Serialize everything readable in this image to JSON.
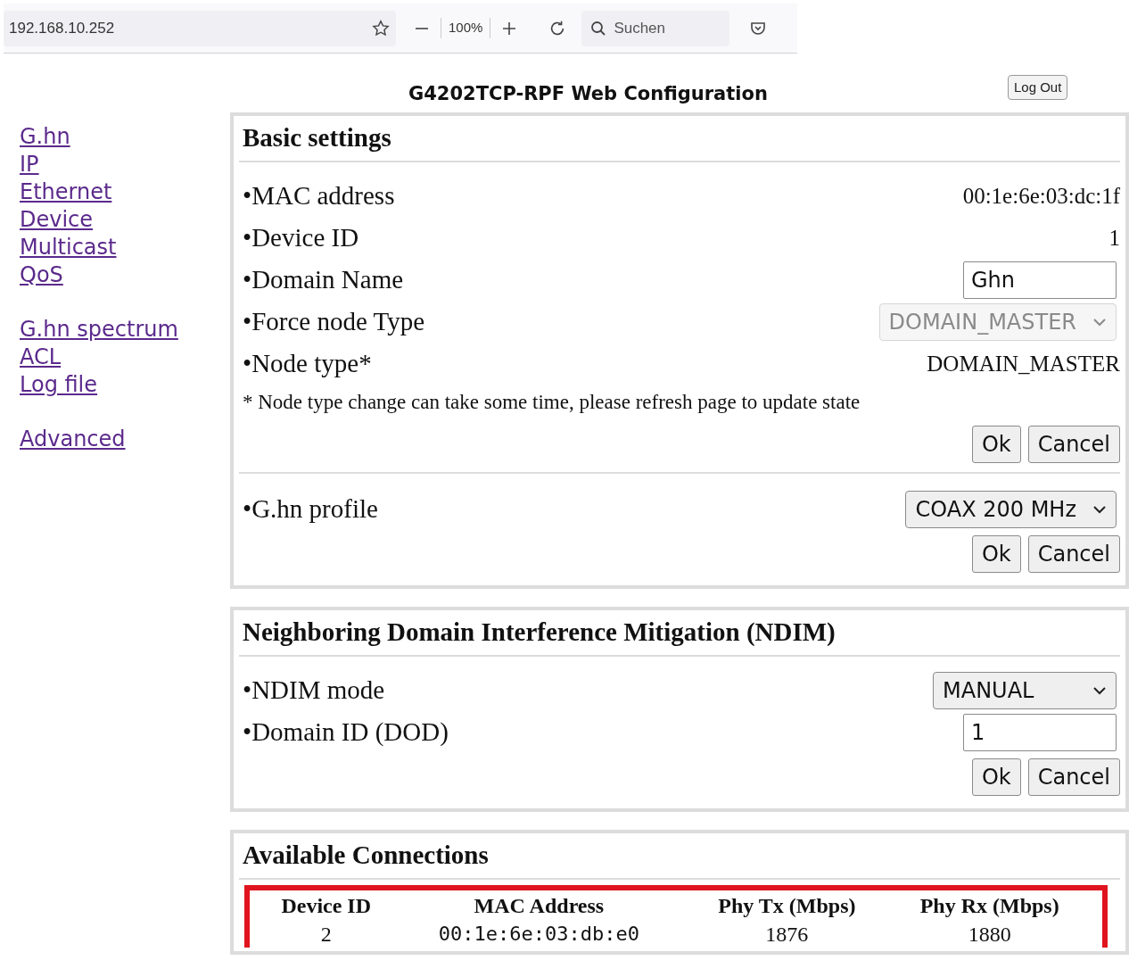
{
  "browser": {
    "address": "192.168.10.252",
    "zoom": "100%",
    "search_placeholder": "Suchen"
  },
  "title": "G4202TCP-RPF Web Configuration",
  "logout": "Log Out",
  "nav": [
    [
      "G.hn",
      "IP",
      "Ethernet",
      "Device",
      "Multicast",
      "QoS"
    ],
    [
      "G.hn spectrum",
      "ACL",
      "Log file"
    ],
    [
      "Advanced"
    ]
  ],
  "sections": [
    {
      "title": "Basic settings",
      "blocks": [
        {
          "rows": [
            {
              "kind": "text",
              "label": "•MAC address",
              "value": "00:1e:6e:03:dc:1f"
            },
            {
              "kind": "text",
              "label": "•Device ID",
              "value": "1"
            },
            {
              "kind": "input",
              "label": "•Domain Name",
              "value": "Ghn"
            },
            {
              "kind": "select",
              "label": "•Force node Type",
              "value": "DOMAIN_MASTER",
              "disabled": true
            },
            {
              "kind": "text",
              "label": "•Node type*",
              "value": "DOMAIN_MASTER"
            }
          ],
          "note": "* Node type change can take some time, please refresh page to update state",
          "buttons": [
            "Ok",
            "Cancel"
          ]
        },
        {
          "rows": [
            {
              "kind": "select",
              "label": "•G.hn profile",
              "value": "COAX 200 MHz",
              "disabled": false
            }
          ],
          "buttons": [
            "Ok",
            "Cancel"
          ]
        }
      ]
    },
    {
      "title": "Neighboring Domain Interference Mitigation (NDIM)",
      "blocks": [
        {
          "rows": [
            {
              "kind": "select",
              "label": "•NDIM mode",
              "value": "MANUAL",
              "disabled": false
            },
            {
              "kind": "input",
              "label": "•Domain ID (DOD)",
              "value": "1"
            }
          ],
          "buttons": [
            "Ok",
            "Cancel"
          ]
        }
      ]
    },
    {
      "title": "Available Connections",
      "table": {
        "highlighted": true,
        "columns": [
          "Device ID",
          "MAC Address",
          "Phy Tx (Mbps)",
          "Phy Rx (Mbps)"
        ],
        "rows": [
          [
            "2",
            "00:1e:6e:03:db:e0",
            "1876",
            "1880"
          ]
        ]
      }
    }
  ]
}
